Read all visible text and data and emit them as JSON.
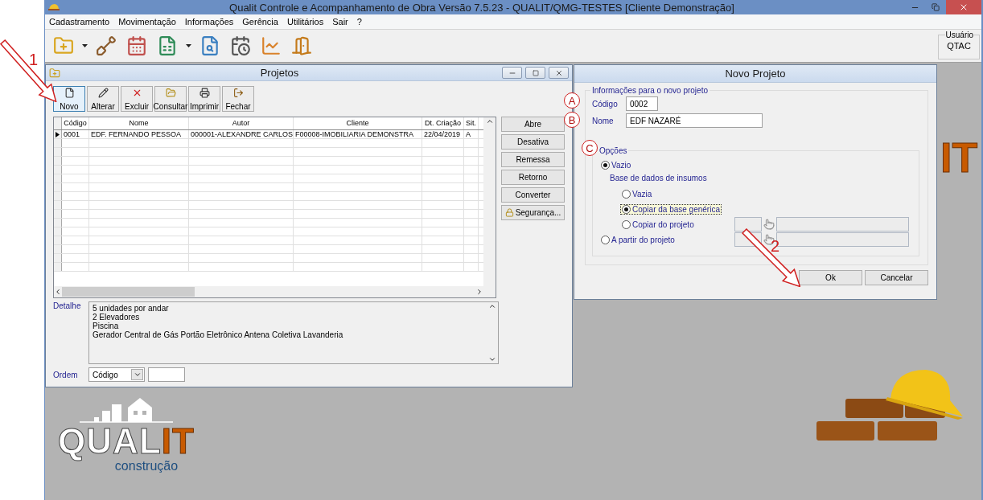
{
  "window": {
    "title": "Qualit Controle e Acompanhamento de Obra Versão 7.5.23 - QUALIT/QMG-TESTES [Cliente Demonstração]"
  },
  "menu": [
    "Cadastramento",
    "Movimentação",
    "Informações",
    "Gerência",
    "Utilitários",
    "Sair",
    "?"
  ],
  "user_box": {
    "legend": "Usuário",
    "value": "QTAC"
  },
  "projects_window": {
    "title": "Projetos",
    "toolbar": [
      {
        "label": "Novo",
        "highlighted": true
      },
      {
        "label": "Alterar",
        "highlighted": false
      },
      {
        "label": "Excluir",
        "highlighted": false
      },
      {
        "label": "Consultar",
        "highlighted": false
      },
      {
        "label": "Imprimir",
        "highlighted": false
      },
      {
        "label": "Fechar",
        "highlighted": false
      }
    ],
    "table": {
      "columns": [
        "Código",
        "Nome",
        "Autor",
        "Cliente",
        "Dt. Criação",
        "Sit."
      ],
      "rows": [
        {
          "current": true,
          "cells": [
            "0001",
            "EDF. FERNANDO PESSOA",
            "000001-ALEXANDRE CARLOS",
            "F00008-IMOBILIARIA DEMONSTRA",
            "22/04/2019",
            "A"
          ]
        }
      ]
    },
    "side_buttons": [
      {
        "label": "Abre",
        "kind": "plain"
      },
      {
        "label": "Desativa",
        "kind": "plain"
      },
      {
        "label": "Remessa",
        "kind": "plain"
      },
      {
        "label": "Retorno",
        "kind": "plain"
      },
      {
        "label": "Converter",
        "kind": "plain"
      },
      {
        "label": "Segurança...",
        "kind": "lock"
      }
    ],
    "detail": {
      "label": "Detalhe",
      "lines": [
        "5 unidades por andar",
        "2 Elevadores",
        "Piscina",
        "Gerador Central de Gás Portão Eletrônico Antena Coletiva Lavanderia"
      ]
    },
    "order": {
      "label": "Ordem",
      "value": "Código"
    }
  },
  "dialog": {
    "title": "Novo Projeto",
    "info_group": {
      "legend": "Informações para o novo projeto",
      "fields": [
        {
          "label": "Código",
          "value": "0002",
          "kind": "short"
        },
        {
          "label": "Nome",
          "value": "EDF NAZARÉ",
          "kind": "long"
        }
      ]
    },
    "options": {
      "legend": "Opções",
      "items": [
        {
          "kind": "radio",
          "label": "Vazio",
          "selected": true,
          "focused": false,
          "children": [
            {
              "kind": "heading",
              "label": "Base de dados de insumos",
              "children": [
                {
                  "kind": "radio",
                  "label": "Vazia",
                  "selected": false,
                  "focused": false
                },
                {
                  "kind": "radio",
                  "label": "Copiar da base genérica",
                  "selected": true,
                  "focused": true
                },
                {
                  "kind": "radio_lookup",
                  "label": "Copiar do projeto",
                  "selected": false,
                  "focused": false
                }
              ]
            }
          ]
        },
        {
          "kind": "radio_lookup",
          "label": "A partir do projeto",
          "selected": false,
          "focused": false
        }
      ]
    },
    "buttons": [
      "Ok",
      "Cancelar"
    ]
  },
  "background_logo": {
    "fragment": "IT",
    "word_left": "QUAL",
    "word_right": "IT",
    "tagline": "construção"
  },
  "annotations": [
    {
      "kind": "arrow",
      "label": "1"
    },
    {
      "kind": "circle",
      "label": "A"
    },
    {
      "kind": "circle",
      "label": "B"
    },
    {
      "kind": "circle",
      "label": "C"
    },
    {
      "kind": "arrow",
      "label": "2"
    }
  ]
}
